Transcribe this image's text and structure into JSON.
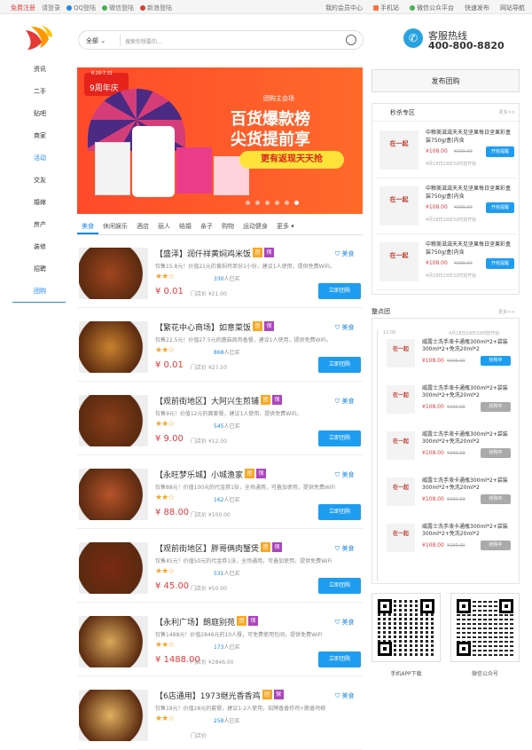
{
  "topbar": {
    "left": [
      "免费注册",
      "请登录",
      "QQ登陆",
      "微信登陆",
      "新浪登陆"
    ],
    "right": [
      "我的会员中心",
      "手机站",
      "微信公众平台",
      "快速发布",
      "网站导航"
    ]
  },
  "search": {
    "category": "全部",
    "placeholder": "搜索你想要的..."
  },
  "hotline": {
    "title": "客服热线",
    "number": "400-800-8820"
  },
  "nav": [
    "资讯",
    "二手",
    "贴吧",
    "商家",
    "活动",
    "交友",
    "婚嫁",
    "房产",
    "装修",
    "招聘",
    "团购"
  ],
  "banner": {
    "badge": "9周年庆",
    "dates": "6.20-7.31",
    "tag": "团购主会场",
    "line1": "百货爆款榜",
    "line2": "尖货提前享",
    "pill": "更有返现天天抢"
  },
  "tabs": [
    "美食",
    "休闲娱乐",
    "酒店",
    "丽人",
    "结婚",
    "亲子",
    "购物",
    "运动健身",
    "更多"
  ],
  "deals": [
    {
      "title": "【盛泽】润仟祥黄焖鸡米饭",
      "desc": "仅售15.8元！价值21元的黄焖鸡单份1小份，建议1人使用，提供免费WiFi。",
      "stars": "★★☆",
      "sold": "330",
      "price": "¥ 0.01",
      "orig": "¥21.00",
      "tag": "美食"
    },
    {
      "title": "【繁花中心商场】如意菜饭",
      "desc": "仅售22.5元！价值27.5元的菌菇商肉香餐，建议1人使用，提供免费WiFi。",
      "stars": "★★☆",
      "sold": "868",
      "price": "¥ 0.01",
      "orig": "¥27.50",
      "tag": "美食"
    },
    {
      "title": "【观前街地区】大阿兴生煎铺",
      "desc": "仅售9元！价值12元的面套餐，建议1人使用，提供免费WiFi。",
      "stars": "★★☆",
      "sold": "545",
      "price": "¥ 9.00",
      "orig": "¥12.00",
      "tag": "美食"
    },
    {
      "title": "【永旺梦乐城】小城渔家",
      "desc": "仅售88元！价值100元的代金券1张，全场通用，可叠加使用，提供免费WiFi",
      "stars": "★★☆",
      "sold": "162",
      "price": "¥ 88.00",
      "orig": "¥100.00",
      "tag": "美食"
    },
    {
      "title": "【观前街地区】胖哥俩肉蟹煲",
      "desc": "仅售45元！价值50元的代金券1张，全场通用，可叠加使用，提供免费WiFi",
      "stars": "★★☆",
      "sold": "531",
      "price": "¥ 45.00",
      "orig": "¥50.00",
      "tag": "美食"
    },
    {
      "title": "【永利广场】朗庭别苑",
      "desc": "仅售1488元！价值2846元的10人餐，可免费使用包间，提供免费WiFi",
      "stars": "★★☆",
      "sold": "173",
      "price": "¥ 1488.00",
      "orig": "¥2846.00",
      "tag": "美食"
    },
    {
      "title": "【6店通用】1973继光香香鸡",
      "desc": "仅售18元！价值28元的套餐，建议1-2人使用，招牌香香炸鸡+脆香鸡柳",
      "stars": "★★☆",
      "sold": "258",
      "price": "",
      "orig": "",
      "tag": "美食"
    }
  ],
  "deal_button": "立即团购",
  "badge_labels": {
    "b1": "团",
    "b2": "保"
  },
  "orig_prefix": "门店价",
  "sold_suffix": "人已买",
  "right": {
    "publish": "发布团购",
    "miaosha_title": "秒杀专区",
    "more": "更多>>",
    "miaosha": [
      {
        "name": "中粮美滋滋天天见坚果每日坚果彩盒装750g/盒(内含",
        "price": "¥108.00",
        "orig": "¥200.00",
        "btn": "开抢提醒",
        "time": "4月18日29日32时前开始"
      },
      {
        "name": "中粮美滋滋天天见坚果每日坚果彩盒装750g/盒(内含",
        "price": "¥108.00",
        "orig": "¥200.00",
        "btn": "开抢提醒",
        "time": "4月18日29日32时前开始"
      },
      {
        "name": "中粮美滋滋天天见坚果每日坚果彩盒装750g/盒(内含",
        "price": "¥108.00",
        "orig": "¥200.00",
        "btn": "开抢提醒",
        "time": "4月18日29日32时前开始"
      }
    ],
    "pic_label": "在一起",
    "zhengdian_title": "整点团",
    "groups": [
      {
        "time": "12:00",
        "time2": "4月18日29日32时前开始",
        "name": "威露士洗手液卡通瓶300ml*2+袋装300ml*2+免洗20ml*2",
        "price": "¥108.00",
        "orig": "¥200.00",
        "btn": "抢购中",
        "active": true
      },
      {
        "name": "威露士洗手液卡通瓶300ml*2+袋装300ml*2+免洗20ml*2",
        "price": "¥108.00",
        "orig": "¥200.00",
        "btn": "抢购中",
        "active": false
      },
      {
        "name": "威露士洗手液卡通瓶300ml*2+袋装300ml*2+免洗20ml*2",
        "price": "¥108.00",
        "orig": "¥200.00",
        "btn": "抢购中",
        "active": false
      },
      {
        "name": "威露士洗手液卡通瓶300ml*2+袋装300ml*2+免洗20ml*2",
        "price": "¥108.00",
        "orig": "¥200.00",
        "btn": "抢购中",
        "active": false
      },
      {
        "name": "威露士洗手液卡通瓶300ml*2+袋装300ml*2+免洗20ml*2",
        "price": "¥108.00",
        "orig": "¥200.00",
        "btn": "抢购中",
        "active": false
      }
    ],
    "qr_labels": [
      "手机APP下载",
      "微信公众号"
    ]
  }
}
